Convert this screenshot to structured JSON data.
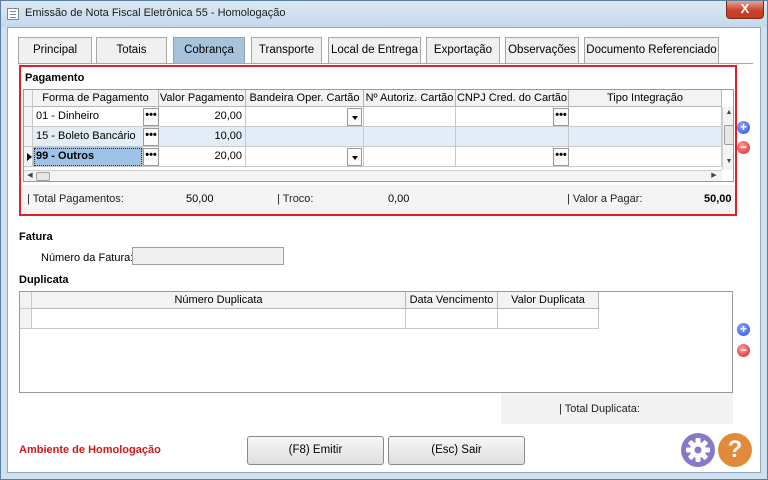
{
  "window": {
    "title": "Emissão de Nota Fiscal Eletrônica 55 - Homologação",
    "close_glyph": "X"
  },
  "tabs": [
    {
      "label": "Principal"
    },
    {
      "label": "Totais"
    },
    {
      "label": "Cobrança"
    },
    {
      "label": "Transporte"
    },
    {
      "label": "Local de Entrega"
    },
    {
      "label": "Exportação"
    },
    {
      "label": "Observações"
    },
    {
      "label": "Documento Referenciado"
    }
  ],
  "active_tab": "Cobrança",
  "pagamento": {
    "title": "Pagamento",
    "columns": [
      "Forma de Pagamento",
      "Valor Pagamento",
      "Bandeira Oper. Cartão",
      "Nº Autoriz. Cartão",
      "CNPJ Cred. do Cartão",
      "Tipo Integração"
    ],
    "rows": [
      {
        "forma": "01 - Dinheiro",
        "valor": "20,00"
      },
      {
        "forma": "15 - Boleto Bancário",
        "valor": "10,00"
      },
      {
        "forma": "99 - Outros",
        "valor": "20,00"
      }
    ],
    "ellipsis": "•••",
    "totals": {
      "total_label": "| Total Pagamentos:",
      "total_value": "50,00",
      "troco_label": "| Troco:",
      "troco_value": "0,00",
      "pagar_label": "| Valor a Pagar:",
      "pagar_value": "50,00"
    }
  },
  "fatura": {
    "title": "Fatura",
    "numero_label": "Número da Fatura:",
    "numero_value": ""
  },
  "duplicata": {
    "title": "Duplicata",
    "columns": [
      "Número Duplicata",
      "Data Vencimento",
      "Valor Duplicata"
    ],
    "total_label": "| Total Duplicata:"
  },
  "footer": {
    "env_text": "Ambiente de Homologação",
    "emit_label": "(F8) Emitir",
    "exit_label": "(Esc) Sair",
    "help_glyph": "?"
  },
  "colors": {
    "accent": "#a9c2dc",
    "highlight_border": "#e0202a",
    "env_text": "#d01818"
  }
}
